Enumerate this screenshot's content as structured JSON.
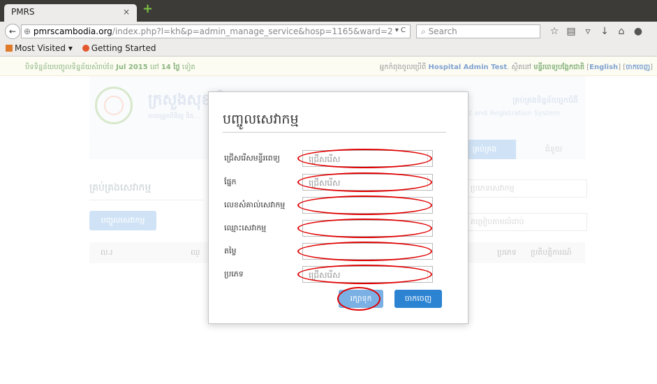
{
  "browser": {
    "tab_title": "PMRS",
    "tab_close": "×",
    "new_tab": "+",
    "url_domain": "pmrscambodia.org",
    "url_path": "/index.php?l=kh&p=admin_manage_service&hosp=1165&ward=2",
    "search_placeholder": "Search",
    "bookmarks": [
      "Most Visited ▾",
      "Getting Started"
    ]
  },
  "infobar": {
    "left_text": "បិទទិន្នន័យបញ្ចូលទិន្នន័យសំរាប់ខែ",
    "month": "Jul 2015",
    "left_mid": "នៅ",
    "days": "14 ថ្ងៃ",
    "left_end": "ទៀត",
    "right_text": "អ្នកកំពុងចូលប្រើពី",
    "user_link": "Hospital Admin Test",
    "right_mid": "ស្ថិតនៅ",
    "dept": "មន្ទីរពេទ្យបង្អែកជាតិ",
    "lang": "English",
    "logout": "ចាកចេញ"
  },
  "header": {
    "title": "ក្រសួងសុខាភិបាល",
    "subtitle": "ចាយគ្រួតពិនិត្យ និង...",
    "right1": "គ្រប់គ្រងទិន្នន័យអ្នកជំងឺ",
    "right2": "nt and Registration System"
  },
  "menu": {
    "active": "គ្រប់គ្រង",
    "item2": "ជំនួយ"
  },
  "background": {
    "section_title": "គ្រប់គ្រងសេវាកម្ម",
    "add_button": "បញ្ចូលសេវាកម្ម",
    "select1": "ប្រភេទសេវាកម្ម",
    "select2": "តម្រៀបតាមលំដាប់",
    "col_no": "ល.រ",
    "col_name": "ឈ្",
    "col_type": "ប្រភេទ",
    "col_date": "ប្រតិបត្តិការណ៍"
  },
  "modal": {
    "title": "បញ្ចូលសេវាកម្ម",
    "fields": [
      {
        "label": "ជ្រើសរើសមន្ទីរពេទ្យ",
        "value": "ជ្រើសរើស"
      },
      {
        "label": "ផ្នែក",
        "value": "ជ្រើសរើស"
      },
      {
        "label": "លេខសំគាល់សេវាកម្ម",
        "value": ""
      },
      {
        "label": "ឈ្មោះសេវាកម្ម",
        "value": ""
      },
      {
        "label": "តម្លៃ",
        "value": ""
      },
      {
        "label": "ប្រភេទ",
        "value": "ជ្រើសរើស"
      }
    ],
    "save": "រក្សាទុក",
    "exit": "ចាកចេញ"
  },
  "colors": {
    "ring": "#e00000",
    "primary": "#2b83d2"
  }
}
